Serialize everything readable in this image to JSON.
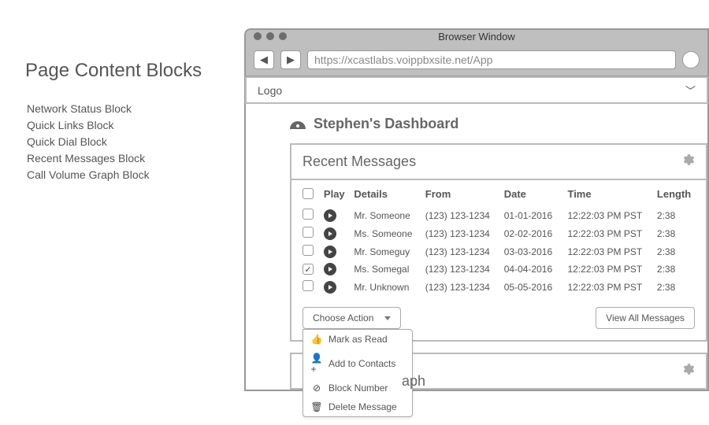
{
  "left": {
    "title": "Page Content Blocks",
    "items": [
      "Network Status Block",
      "Quick Links Block",
      "Quick Dial Block",
      "Recent Messages Block",
      "Call Volume Graph Block"
    ]
  },
  "browser": {
    "title": "Browser Window",
    "url": "https://xcastlabs.voippbxsite.net/App"
  },
  "logo_bar": {
    "label": "Logo"
  },
  "dashboard": {
    "title": "Stephen's Dashboard"
  },
  "messages_card": {
    "title": "Recent Messages",
    "columns": {
      "play": "Play",
      "details": "Details",
      "from": "From",
      "date": "Date",
      "time": "Time",
      "length": "Length"
    },
    "rows": [
      {
        "checked": false,
        "details": "Mr. Someone",
        "from": "(123) 123-1234",
        "date": "01-01-2016",
        "time": "12:22:03 PM PST",
        "length": "2:38"
      },
      {
        "checked": false,
        "details": "Ms. Someone",
        "from": "(123) 123-1234",
        "date": "02-02-2016",
        "time": "12:22:03 PM PST",
        "length": "2:38"
      },
      {
        "checked": false,
        "details": "Mr. Someguy",
        "from": "(123) 123-1234",
        "date": "03-03-2016",
        "time": "12:22:03 PM PST",
        "length": "2:38"
      },
      {
        "checked": true,
        "details": "Ms. Somegal",
        "from": "(123) 123-1234",
        "date": "04-04-2016",
        "time": "12:22:03 PM PST",
        "length": "2:38"
      },
      {
        "checked": false,
        "details": "Mr. Unknown",
        "from": "(123) 123-1234",
        "date": "05-05-2016",
        "time": "12:22:03 PM PST",
        "length": "2:38"
      }
    ],
    "action_select": "Choose Action",
    "view_all": "View All Messages",
    "dropdown": [
      {
        "icon": "thumb-up-icon",
        "glyph": "👍",
        "label": "Mark as Read"
      },
      {
        "icon": "add-contact-icon",
        "glyph": "👤+",
        "label": "Add to Contacts"
      },
      {
        "icon": "block-icon",
        "glyph": "⊘",
        "label": "Block Number"
      },
      {
        "icon": "trash-icon",
        "glyph": "🗑",
        "label": "Delete Message"
      }
    ]
  },
  "second_card": {
    "title_suffix": "aph"
  }
}
